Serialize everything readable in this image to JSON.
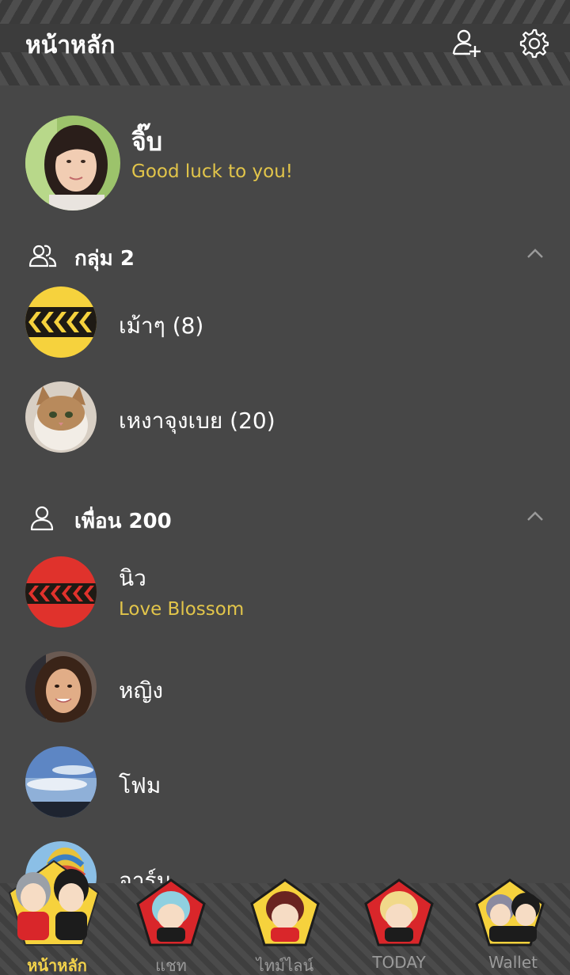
{
  "header": {
    "title": "หน้าหลัก",
    "add_friend_icon": "add-friend-icon",
    "settings_icon": "gear-icon"
  },
  "profile": {
    "name": "จิ๊บ",
    "status": "Good luck to you!"
  },
  "groups_section": {
    "title": "กลุ่ม 2",
    "icon": "group-icon"
  },
  "groups": [
    {
      "name": "เม้าๆ (8)"
    },
    {
      "name": "เหงาจุงเบย (20)"
    }
  ],
  "friends_section": {
    "title": "เพื่อน 200",
    "icon": "person-icon"
  },
  "friends": [
    {
      "name": "นิว",
      "status": "Love Blossom"
    },
    {
      "name": "หญิง"
    },
    {
      "name": "โฟม"
    },
    {
      "name": "อาร์ม"
    }
  ],
  "tabs": [
    {
      "label": "หน้าหลัก",
      "active": true
    },
    {
      "label": "แชท"
    },
    {
      "label": "ไทม์ไลน์"
    },
    {
      "label": "TODAY"
    },
    {
      "label": "Wallet"
    }
  ],
  "colors": {
    "background": "#474747",
    "header": "#3a3a3a",
    "accent_yellow": "#e2c54a",
    "tab_red": "#d9262a",
    "tab_yellow": "#f6d23d"
  }
}
